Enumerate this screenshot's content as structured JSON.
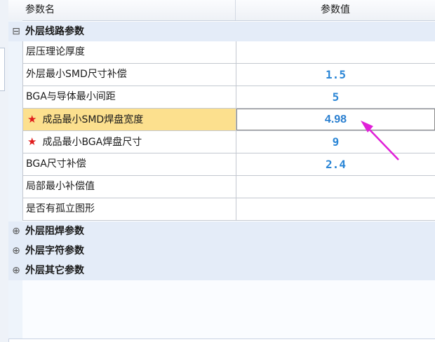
{
  "header": {
    "name_col": "参数名",
    "value_col": "参数值"
  },
  "groups": [
    {
      "label": "外层线路参数",
      "toggle": "⊟",
      "expanded": true
    },
    {
      "label": "外层阻焊参数",
      "toggle": "⊕",
      "expanded": false
    },
    {
      "label": "外层字符参数",
      "toggle": "⊕",
      "expanded": false
    },
    {
      "label": "外层其它参数",
      "toggle": "⊕",
      "expanded": false
    }
  ],
  "params": [
    {
      "name": "层压理论厚度",
      "value": "",
      "starred": false,
      "selected": false
    },
    {
      "name": "外层最小SMD尺寸补偿",
      "value": "1.5",
      "starred": false,
      "selected": false
    },
    {
      "name": "BGA与导体最小间距",
      "value": "5",
      "starred": false,
      "selected": false
    },
    {
      "name": "成品最小SMD焊盘宽度",
      "value": "4.98",
      "starred": true,
      "selected": true
    },
    {
      "name": "成品最小BGA焊盘尺寸",
      "value": "9",
      "starred": true,
      "selected": false
    },
    {
      "name": "BGA尺寸补偿",
      "value": "2.4",
      "starred": false,
      "selected": false
    },
    {
      "name": "局部最小补偿值",
      "value": "",
      "starred": false,
      "selected": false
    },
    {
      "name": "是否有孤立图形",
      "value": "",
      "starred": false,
      "selected": false
    }
  ],
  "colors": {
    "value_text": "#2b86d6",
    "selected_row": "#fce08e",
    "group_bg": "#e4ecf8",
    "star": "#e01b1b",
    "arrow": "#e020d8"
  },
  "icons": {
    "star": "star-icon",
    "arrow": "pointer-arrow-icon"
  }
}
